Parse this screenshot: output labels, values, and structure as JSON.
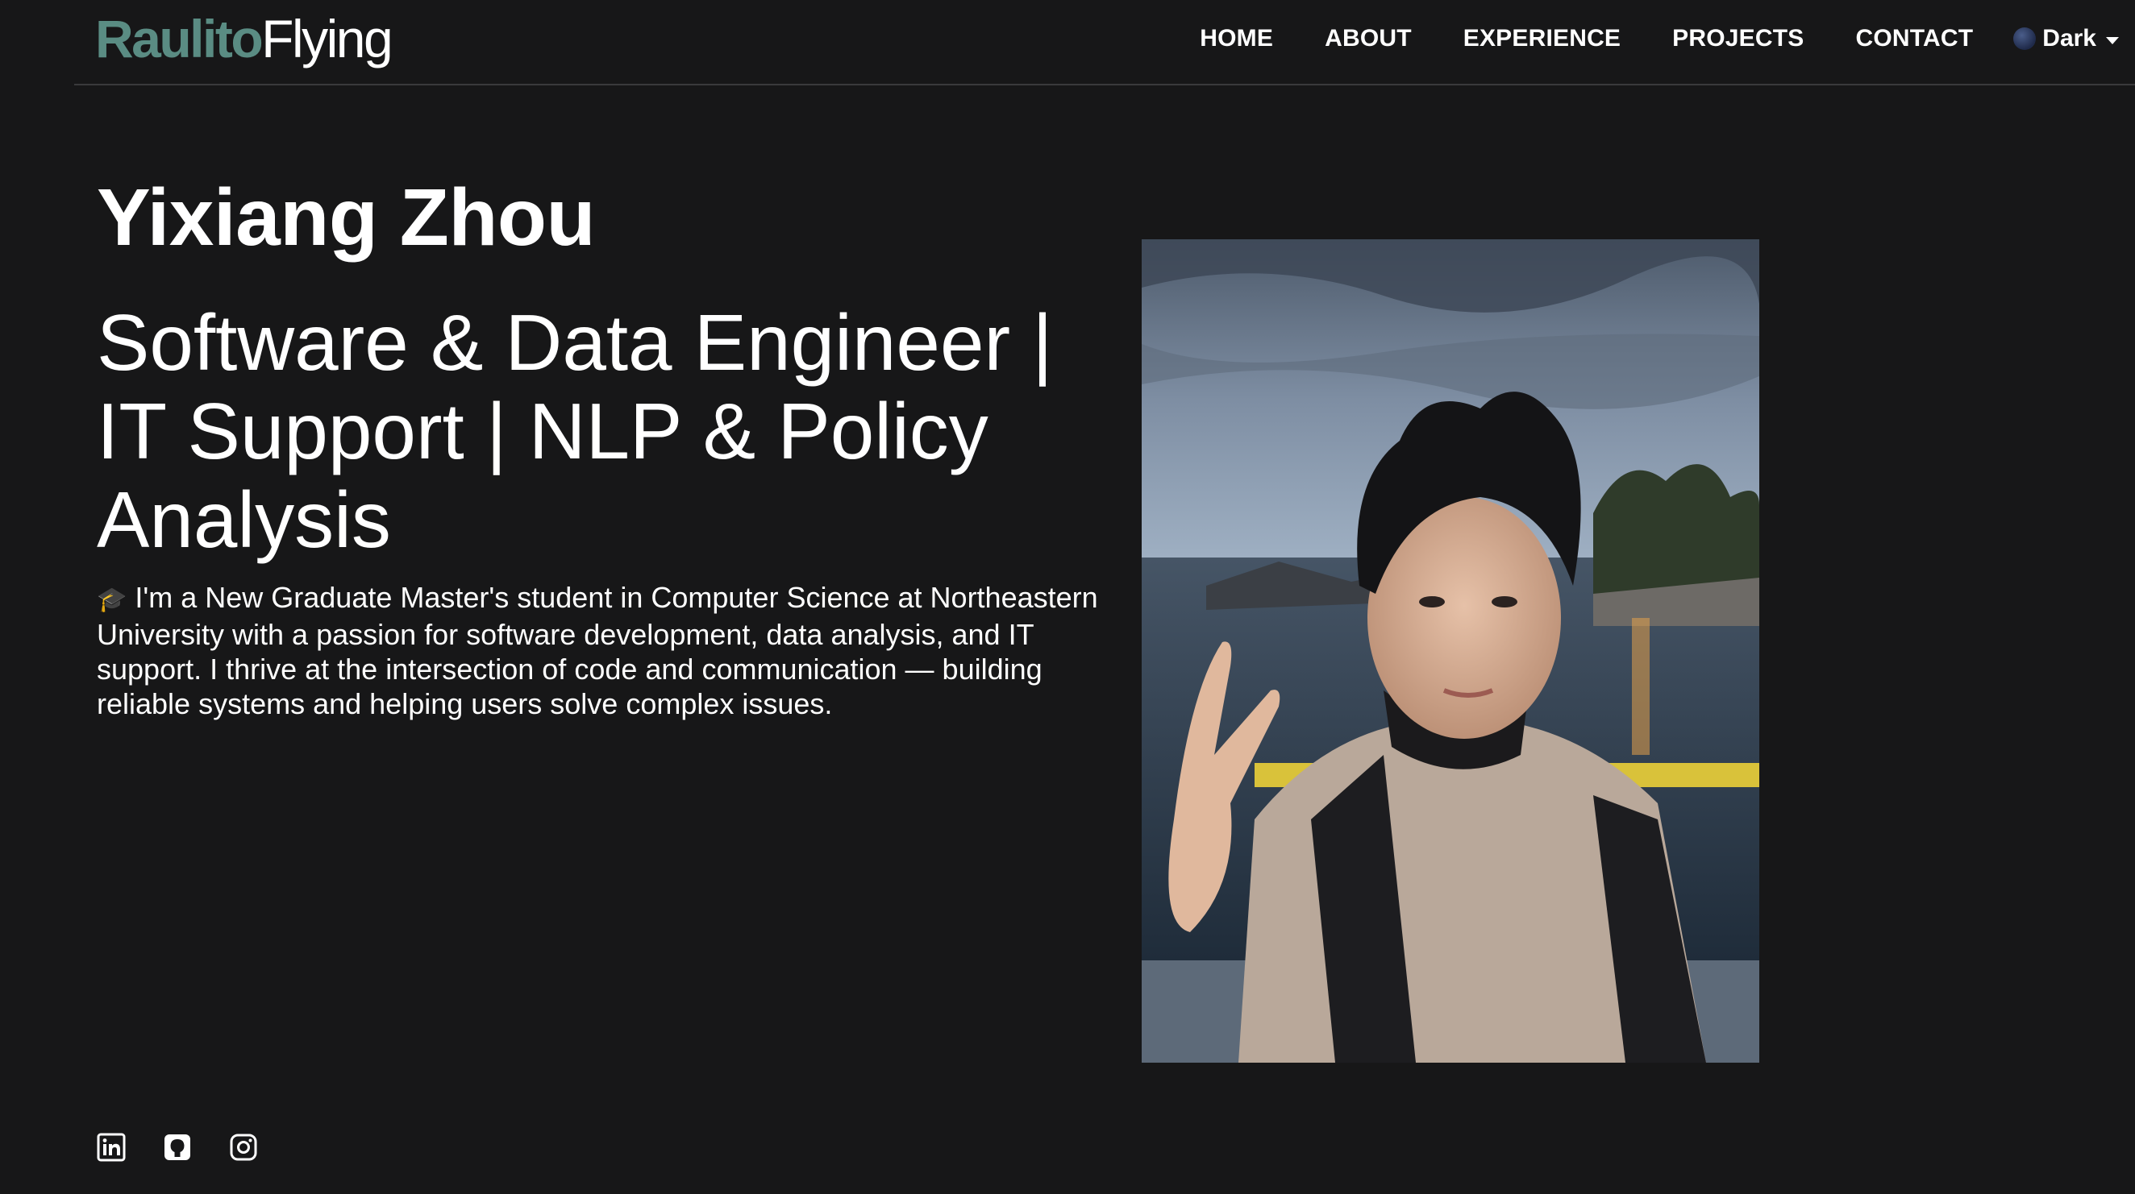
{
  "brand": {
    "part1": "Raulito",
    "part2": "Flying"
  },
  "nav": {
    "links": [
      "HOME",
      "ABOUT",
      "EXPERIENCE",
      "PROJECTS",
      "CONTACT"
    ],
    "theme_label": "Dark",
    "theme_icon": "moon-icon"
  },
  "hero": {
    "name": "Yixiang Zhou",
    "headline": "Software & Data Engineer | IT Support | NLP & Policy Analysis",
    "bio_icon": "🎓",
    "bio": "I'm a New Graduate Master's student in Computer Science at Northeastern University with a passion for software development, data analysis, and IT support. I thrive at the intersection of code and communication — building reliable systems and helping users solve complex issues."
  },
  "photo": {
    "subject": "portrait-photo"
  },
  "social": {
    "icons": [
      "linkedin-icon",
      "github-icon",
      "instagram-icon"
    ]
  },
  "colors": {
    "background": "#171718",
    "brand_accent": "#5a8c83",
    "text": "#ffffff",
    "divider": "#3a3a3c"
  }
}
